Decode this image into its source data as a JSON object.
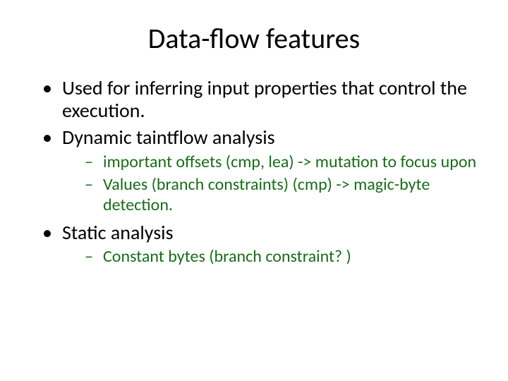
{
  "title": "Data-flow features",
  "bullets": [
    {
      "text": "Used for inferring input properties that control the execution.",
      "children": []
    },
    {
      "text": "Dynamic taintflow analysis",
      "children": [
        " important offsets (cmp, lea) -> mutation to focus upon",
        "Values (branch constraints) (cmp) -> magic-byte detection."
      ]
    },
    {
      "text": "Static analysis",
      "children": [
        "Constant bytes (branch constraint? )"
      ]
    }
  ]
}
